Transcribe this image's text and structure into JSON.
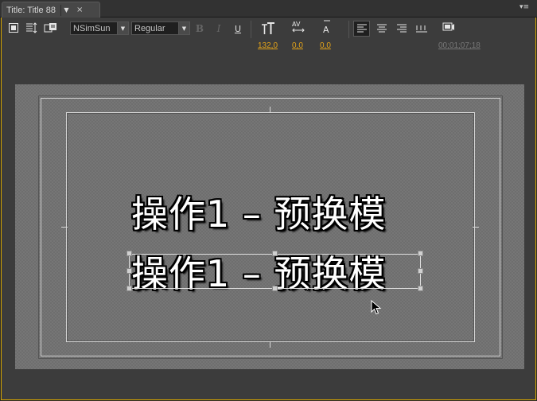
{
  "tab": {
    "title": "Title: Title 88",
    "menu_glyph": "▼",
    "close_glyph": "×"
  },
  "panel_menu_glyph": "▾≡",
  "toolbar": {
    "font_family": "NSimSun",
    "font_style": "Regular",
    "bold_label": "B",
    "italic_label": "I",
    "underline_label": "U",
    "font_size_value": "132,0",
    "kerning_value": "0,0",
    "tracking_value": "0,0",
    "timecode": "00;01;07;18"
  },
  "canvas": {
    "line1": "操作1 – 预换模",
    "line2": "操作1 – 预换模"
  }
}
